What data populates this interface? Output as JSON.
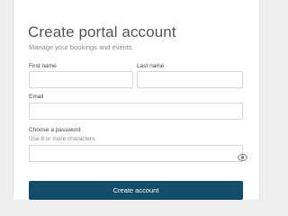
{
  "form": {
    "title": "Create portal account",
    "subtitle": "Manage your bookings and events",
    "first_name": {
      "label": "First name",
      "value": ""
    },
    "last_name": {
      "label": "Last name",
      "value": ""
    },
    "email": {
      "label": "Email",
      "value": ""
    },
    "password": {
      "label": "Choose a password",
      "hint": "Use 8 or more characters.",
      "value": ""
    },
    "submit_label": "Create account"
  },
  "icons": {
    "password_toggle": "eye-icon"
  },
  "colors": {
    "primary": "#134d6a",
    "page_background": "#efefef",
    "card_background": "#ffffff",
    "title_text": "#555555",
    "muted_text": "#8a8a8a",
    "input_border": "#d6d6d6"
  }
}
